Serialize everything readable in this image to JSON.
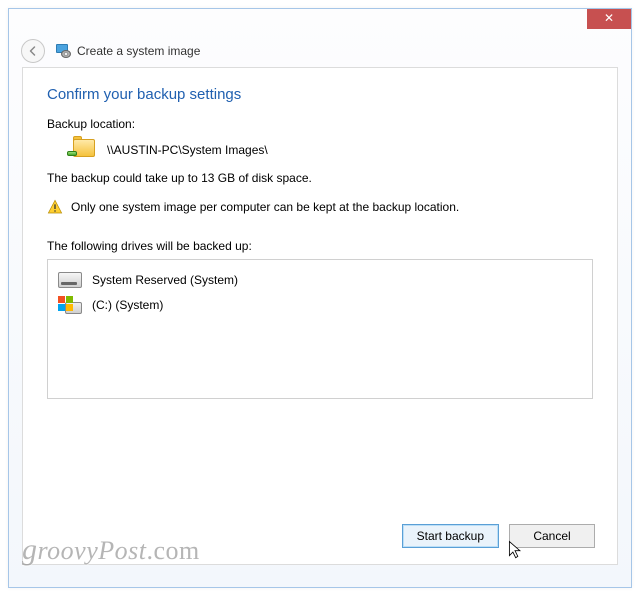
{
  "window": {
    "title": "Create a system image",
    "close_glyph": "✕"
  },
  "main": {
    "heading": "Confirm your backup settings",
    "location_label": "Backup location:",
    "location_path": "\\\\AUSTIN-PC\\System Images\\",
    "size_note": "The backup could take up to 13 GB of disk space.",
    "warning": "Only one system image per computer can be kept at the backup location.",
    "drives_heading": "The following drives will be backed up:",
    "drives": [
      {
        "label": "System Reserved (System)"
      },
      {
        "label": "(C:) (System)"
      }
    ]
  },
  "buttons": {
    "start": "Start backup",
    "cancel": "Cancel"
  },
  "watermark": "groovyPost.com"
}
